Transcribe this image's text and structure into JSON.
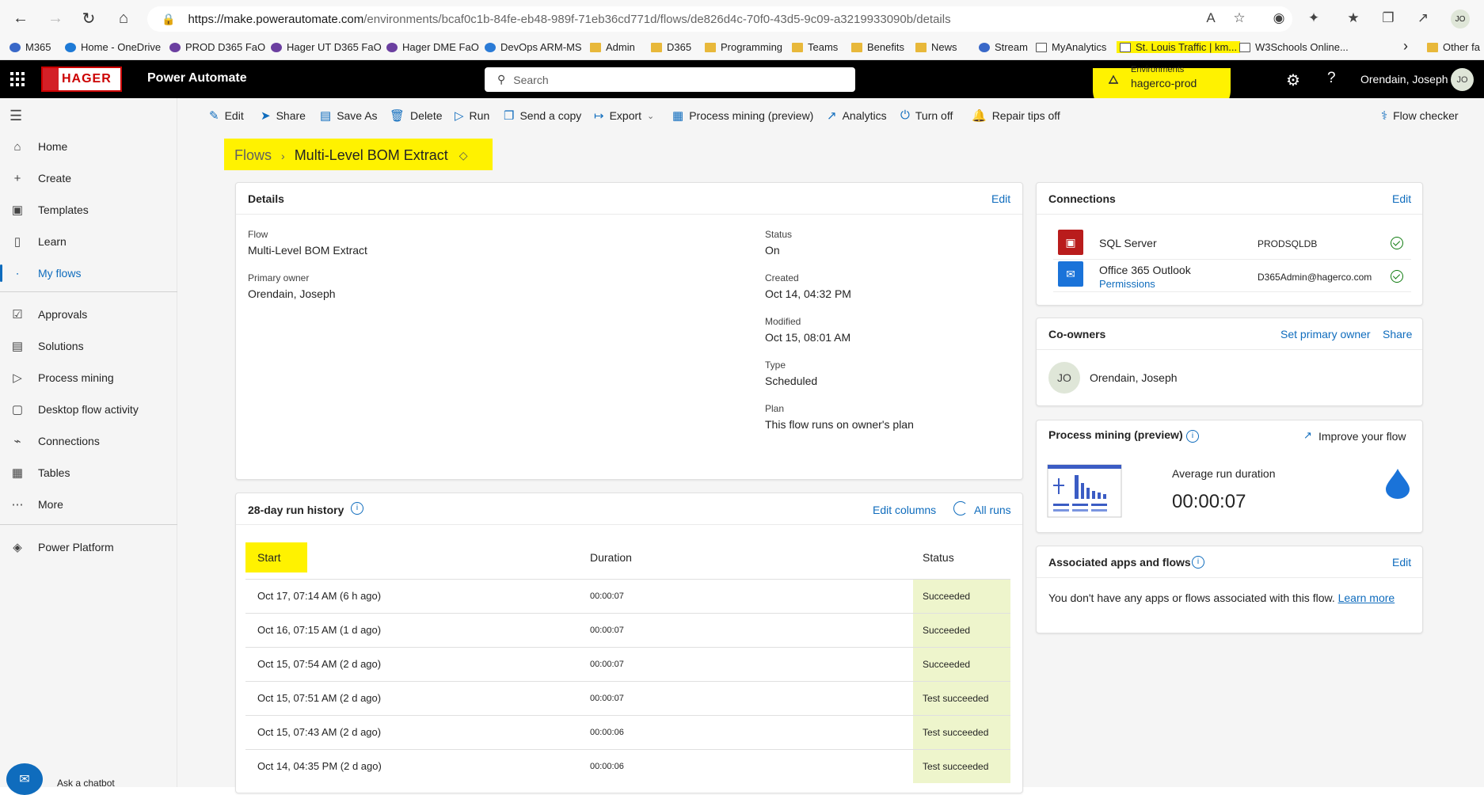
{
  "browser": {
    "url_host": "https://make.powerautomate.com",
    "url_path": "/environments/bcaf0c1b-84fe-eb48-989f-71eb36cd771d/flows/de826d4c-70f0-43d5-9c09-a3219933090b/details",
    "profile_initials": "JO"
  },
  "bookmarks": [
    {
      "label": "M365",
      "icon": "m365-icon"
    },
    {
      "label": "Home - OneDrive",
      "icon": "onedrive-icon"
    },
    {
      "label": "PROD D365 FaO",
      "icon": "d365-icon"
    },
    {
      "label": "Hager UT D365 FaO",
      "icon": "d365-icon"
    },
    {
      "label": "Hager DME FaO",
      "icon": "d365-icon"
    },
    {
      "label": "DevOps ARM-MS",
      "icon": "devops-icon"
    },
    {
      "label": "Admin",
      "icon": "folder-icon"
    },
    {
      "label": "D365",
      "icon": "folder-icon"
    },
    {
      "label": "Programming",
      "icon": "folder-icon"
    },
    {
      "label": "Teams",
      "icon": "folder-icon"
    },
    {
      "label": "Benefits",
      "icon": "folder-icon"
    },
    {
      "label": "News",
      "icon": "folder-icon"
    },
    {
      "label": "Stream",
      "icon": "stream-icon"
    },
    {
      "label": "MyAnalytics",
      "icon": "page-icon"
    },
    {
      "label": "St. Louis Traffic | km...",
      "icon": "page-icon"
    },
    {
      "label": "W3Schools Online...",
      "icon": "page-icon"
    },
    {
      "label": "Other fa",
      "icon": "folder-icon"
    }
  ],
  "header": {
    "logo_text": "HAGER",
    "app_title": "Power Automate",
    "search_placeholder": "Search",
    "environments_label": "Environments",
    "environment_value": "hagerco-prod",
    "user_name": "Orendain, Joseph",
    "user_initials": "JO"
  },
  "nav": {
    "items": [
      {
        "label": "Home",
        "icon": "home-icon"
      },
      {
        "label": "Create",
        "icon": "plus-icon"
      },
      {
        "label": "Templates",
        "icon": "templates-icon"
      },
      {
        "label": "Learn",
        "icon": "book-icon"
      },
      {
        "label": "My flows",
        "icon": "flows-icon",
        "active": true
      },
      {
        "label": "Approvals",
        "icon": "approvals-icon"
      },
      {
        "label": "Solutions",
        "icon": "solutions-icon"
      },
      {
        "label": "Process mining",
        "icon": "process-mining-icon"
      },
      {
        "label": "Desktop flow activity",
        "icon": "desktop-flow-icon"
      },
      {
        "label": "Connections",
        "icon": "connections-icon"
      },
      {
        "label": "Tables",
        "icon": "tables-icon"
      },
      {
        "label": "More",
        "icon": "more-icon"
      },
      {
        "label": "Power Platform",
        "icon": "power-platform-icon"
      }
    ],
    "chatbot_label": "Ask a chatbot"
  },
  "commands": {
    "edit": "Edit",
    "share": "Share",
    "save_as": "Save As",
    "delete": "Delete",
    "run": "Run",
    "send_copy": "Send a copy",
    "export": "Export",
    "process_mining": "Process mining (preview)",
    "analytics": "Analytics",
    "turn_off": "Turn off",
    "repair_tips": "Repair tips off",
    "flow_checker": "Flow checker"
  },
  "breadcrumb": {
    "root": "Flows",
    "current": "Multi-Level BOM Extract"
  },
  "details": {
    "title": "Details",
    "edit": "Edit",
    "flow_label": "Flow",
    "flow_value": "Multi-Level BOM Extract",
    "owner_label": "Primary owner",
    "owner_value": "Orendain, Joseph",
    "status_label": "Status",
    "status_value": "On",
    "created_label": "Created",
    "created_value": "Oct 14, 04:32 PM",
    "modified_label": "Modified",
    "modified_value": "Oct 15, 08:01 AM",
    "type_label": "Type",
    "type_value": "Scheduled",
    "plan_label": "Plan",
    "plan_value": "This flow runs on owner's plan"
  },
  "run_history": {
    "title": "28-day run history",
    "edit_columns": "Edit columns",
    "all_runs": "All runs",
    "col_start": "Start",
    "col_duration": "Duration",
    "col_status": "Status",
    "rows": [
      {
        "start": "Oct 17, 07:14 AM (6 h ago)",
        "duration": "00:00:07",
        "status": "Succeeded"
      },
      {
        "start": "Oct 16, 07:15 AM (1 d ago)",
        "duration": "00:00:07",
        "status": "Succeeded"
      },
      {
        "start": "Oct 15, 07:54 AM (2 d ago)",
        "duration": "00:00:07",
        "status": "Succeeded"
      },
      {
        "start": "Oct 15, 07:51 AM (2 d ago)",
        "duration": "00:00:07",
        "status": "Test succeeded"
      },
      {
        "start": "Oct 15, 07:43 AM (2 d ago)",
        "duration": "00:00:06",
        "status": "Test succeeded"
      },
      {
        "start": "Oct 14, 04:35 PM (2 d ago)",
        "duration": "00:00:06",
        "status": "Test succeeded"
      }
    ]
  },
  "connections": {
    "title": "Connections",
    "edit": "Edit",
    "items": [
      {
        "name": "SQL Server",
        "account": "PRODSQLDB",
        "color": "#b91c1c"
      },
      {
        "name": "Office 365 Outlook",
        "sub_link": "Permissions",
        "account": "D365Admin@hagerco.com",
        "color": "#1a73d9"
      }
    ]
  },
  "coowners": {
    "title": "Co-owners",
    "set_primary": "Set primary owner",
    "share": "Share",
    "initials": "JO",
    "name": "Orendain, Joseph"
  },
  "process_mining": {
    "title": "Process mining (preview)",
    "improve": "Improve your flow",
    "avg_label": "Average run duration",
    "avg_value": "00:00:07"
  },
  "associated": {
    "title": "Associated apps and flows",
    "edit": "Edit",
    "text": "You don't have any apps or flows associated with this flow.",
    "learn_more": "Learn more"
  },
  "colors": {
    "accent": "#0f6cbd",
    "highlight": "#fff200",
    "status_bg": "#eef5cc"
  }
}
